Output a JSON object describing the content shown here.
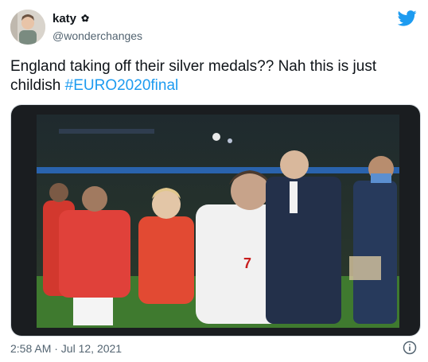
{
  "tweet": {
    "display_name": "katy",
    "verified_icon": "✿",
    "handle": "@wonderchanges",
    "text_main": "England taking off their silver medals?? Nah this is just childish ",
    "hashtag": "#EURO2020final",
    "timestamp": "2:58 AM · Jul 12, 2021"
  },
  "colors": {
    "link": "#1d9bf0",
    "twitter_blue": "#1d9bf0",
    "text": "#0f1419",
    "muted": "#536471"
  },
  "icons": {
    "avatar": "avatar-photo",
    "brand": "twitter-bird-icon",
    "info": "info-icon"
  }
}
